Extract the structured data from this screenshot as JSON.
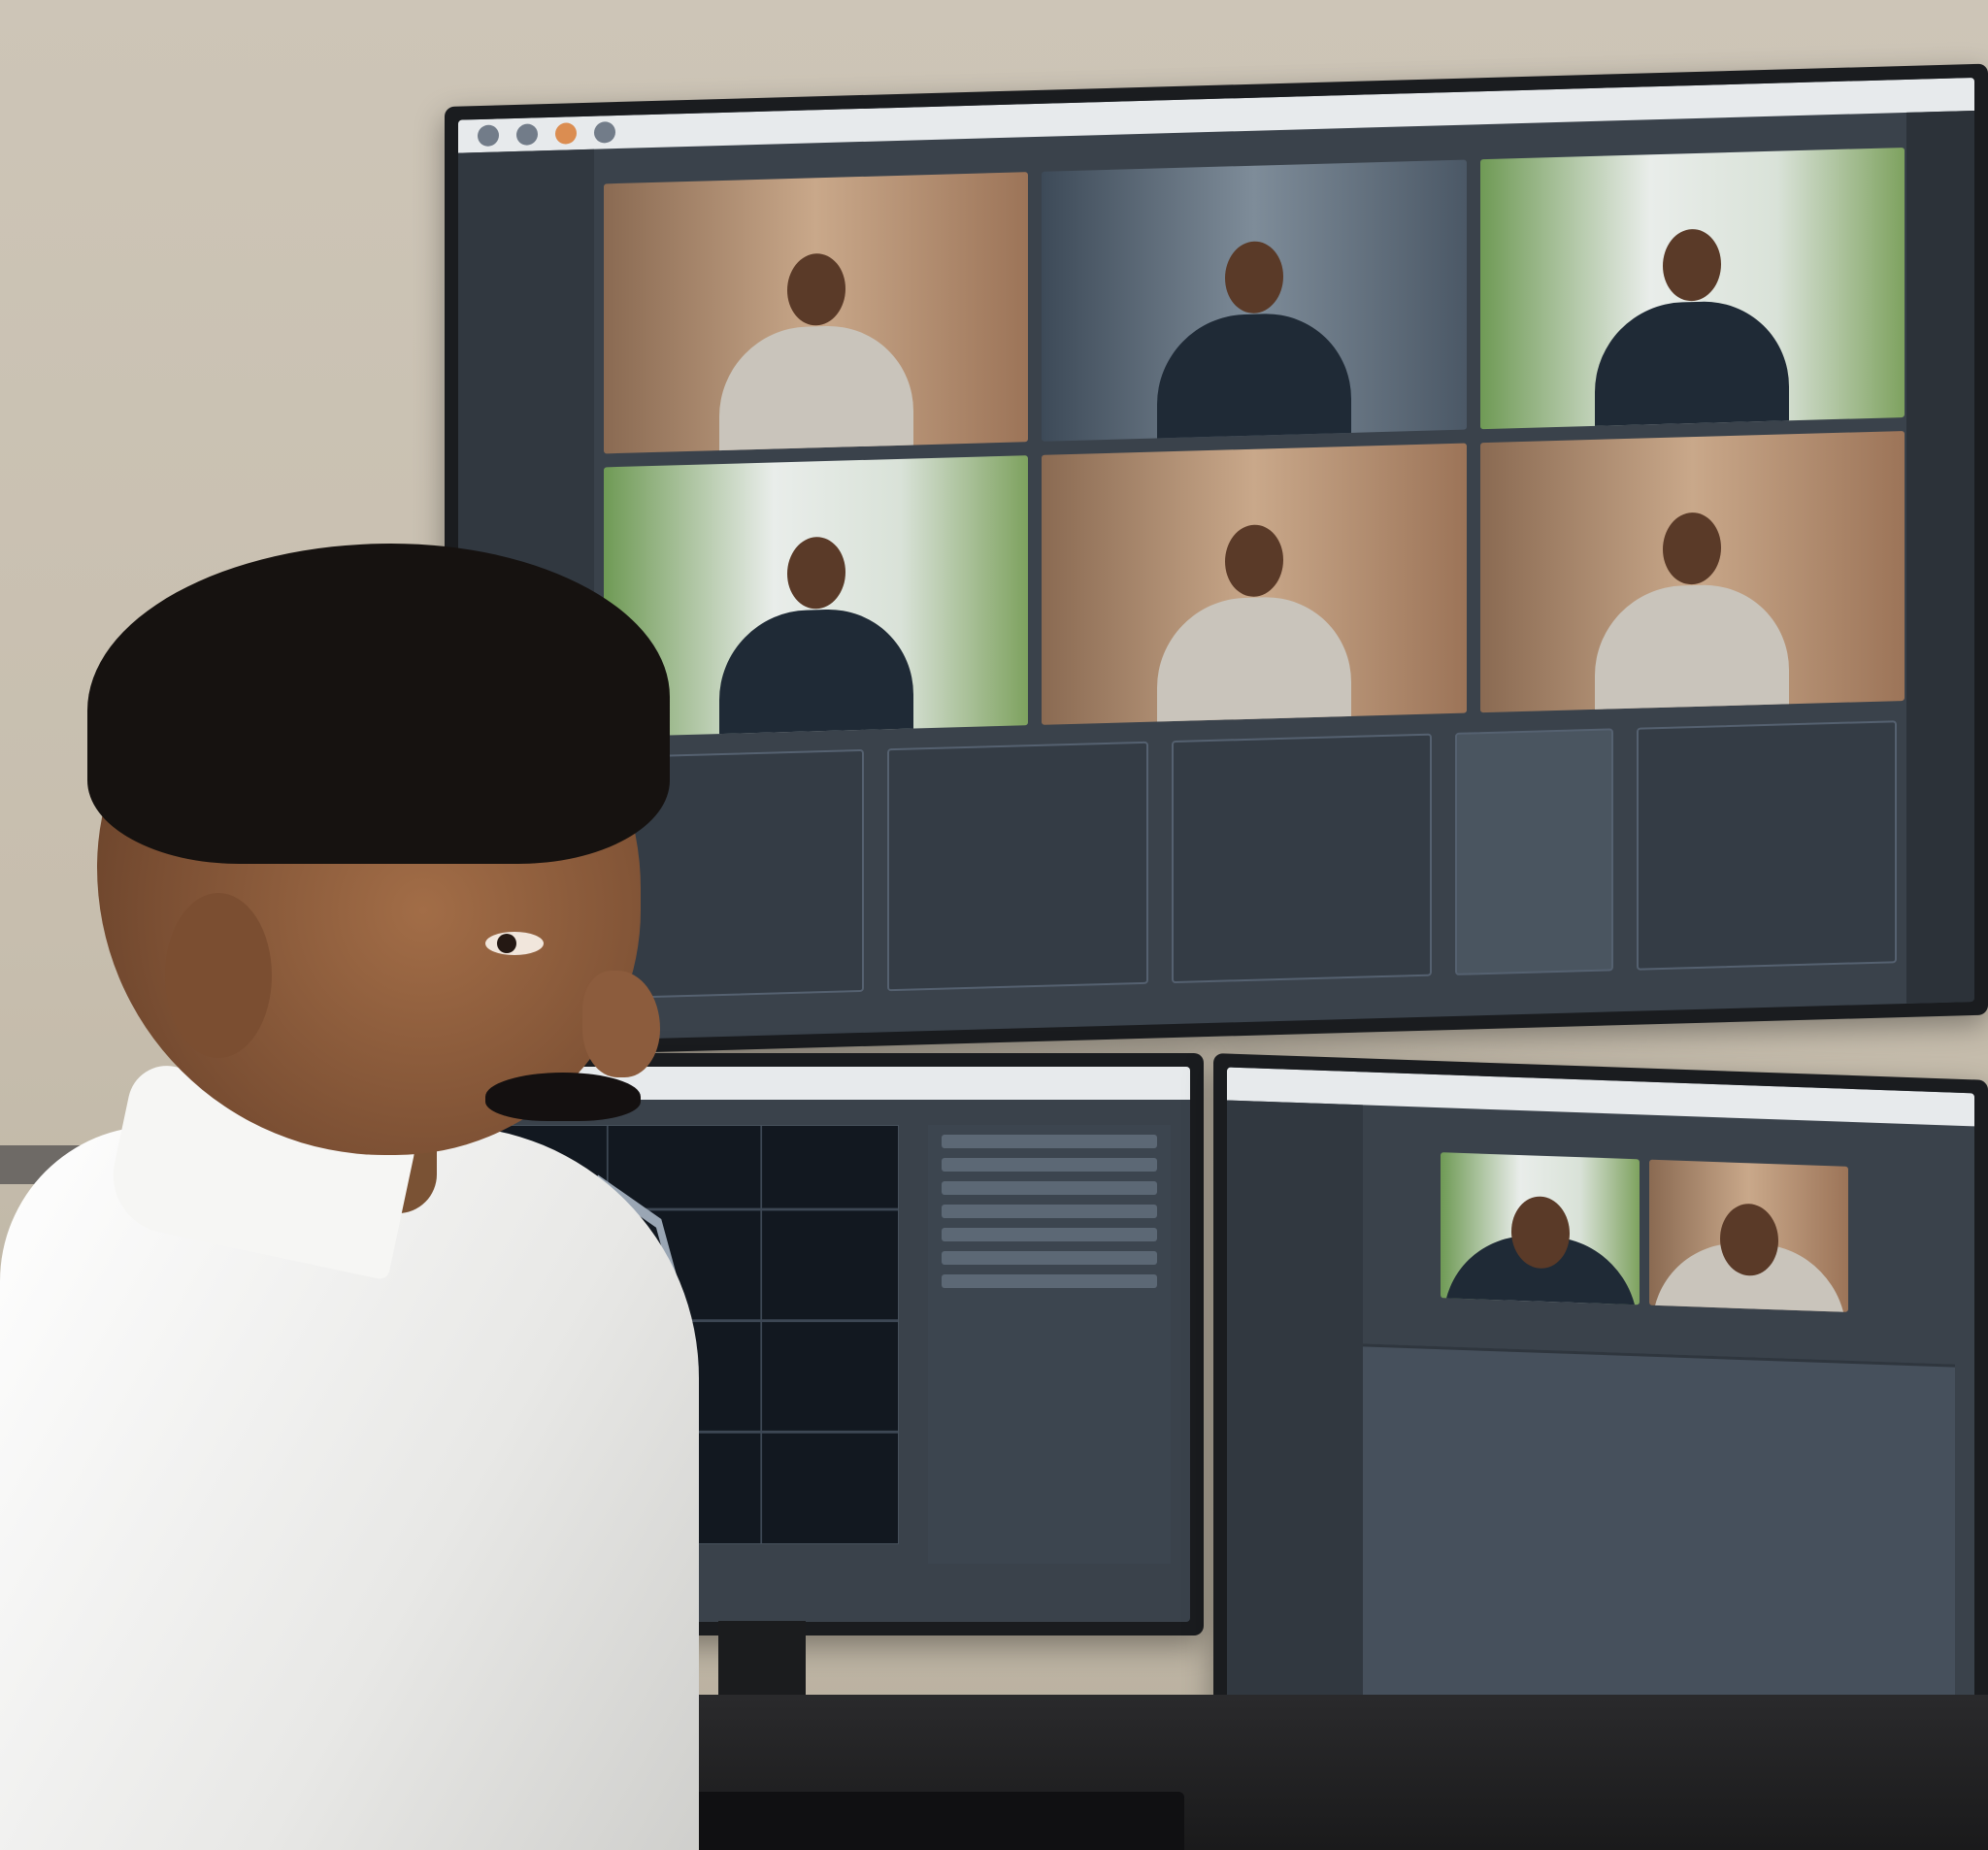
{
  "scene": {
    "subject": "",
    "setting": ""
  },
  "colors": {
    "wall": "#c9c0b1",
    "screen_bg": "#3a424b",
    "shirt": "#f2f2f0",
    "hair": "#161210"
  }
}
